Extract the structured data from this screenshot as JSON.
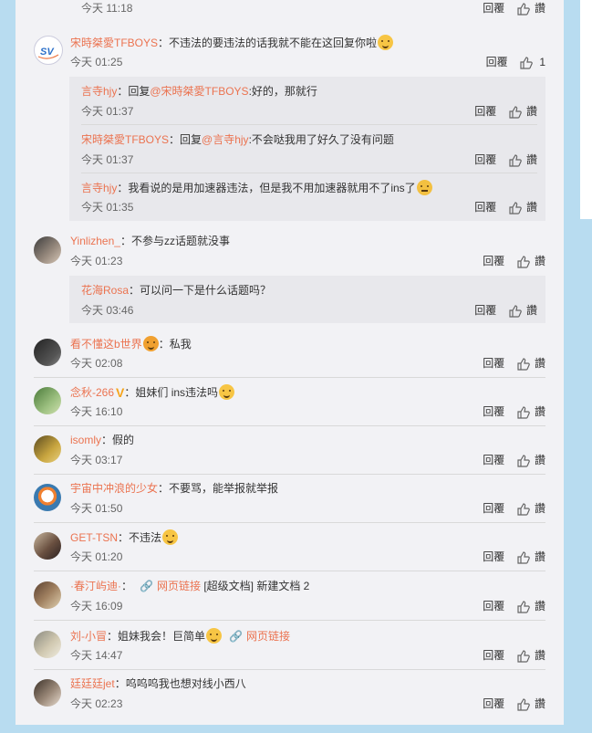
{
  "labels": {
    "reply": "回覆"
  },
  "colors": {
    "username": "#eb7350",
    "panel_bg": "#f2f2f5",
    "subbox_bg": "#e8e8ec",
    "page_bg": "#b8dcf0"
  },
  "top_partial": {
    "time": "今天 11:18"
  },
  "comments": [
    {
      "user": "宋時桀愛TFBOYS",
      "text": "：不违法的要违法的话我就不能在这回复你啦",
      "emoji": "smile-emoji",
      "time": "今天 01:25",
      "likes": "1",
      "avatar": "sv-logo-avatar",
      "replies": [
        {
          "user": "言寺hjy",
          "prefix": "：回复",
          "mention": "@宋時桀愛TFBOYS",
          "text": ":好的，那就行",
          "time": "今天 01:37"
        },
        {
          "user": "宋時桀愛TFBOYS",
          "prefix": "：回复",
          "mention": "@言寺hjy",
          "text": ":不会哒我用了好久了没有问题",
          "time": "今天 01:37"
        },
        {
          "user": "言寺hjy",
          "prefix": "",
          "mention": "",
          "text": "：我看说的是用加速器违法，但是我不用加速器就用不了ins了",
          "emoji": "cry-emoji",
          "time": "今天 01:35"
        }
      ]
    },
    {
      "user": "Yinlizhen_",
      "text": "：不参与zz话题就没事",
      "time": "今天 01:23",
      "avatar": "girl-avatar",
      "replies": [
        {
          "user": "花海Rosa",
          "prefix": "",
          "mention": "",
          "text": "：可以问一下是什么话题吗？",
          "time": "今天 03:46"
        }
      ]
    },
    {
      "user": "看不懂这b世界",
      "text": "：私我",
      "time": "今天 02:08",
      "avatar": "dark-avatar",
      "emoji_after_user": "badge-emoji"
    },
    {
      "user": "念秋-266",
      "text": "：姐妹们 ins违法吗",
      "time": "今天 16:10",
      "avatar": "green-avatar",
      "vip": "V",
      "emoji": "laugh-emoji"
    },
    {
      "user": "isomly",
      "text": "：假的",
      "time": "今天 03:17",
      "avatar": "yellow-avatar"
    },
    {
      "user": "宇宙中冲浪的少女",
      "text": "：不要骂，能举报就举报",
      "time": "今天 01:50",
      "avatar": "cartoon-avatar"
    },
    {
      "user": "GET-TSN",
      "text": "：不违法",
      "time": "今天 01:20",
      "avatar": "boy-avatar",
      "emoji": "laugh-emoji"
    },
    {
      "user": "·春汀屿迪·",
      "text": "：",
      "weblink": "网页链接",
      "after_link": " [超级文档] 新建文档 2",
      "time": "今天 16:09",
      "avatar": "couple-avatar"
    },
    {
      "user": "刘-小冒",
      "text": "：姐妹我会！巨简单",
      "weblink": "网页链接",
      "time": "今天 14:47",
      "avatar": "cat-avatar",
      "emoji": "shock-emoji"
    },
    {
      "user": "廷廷廷jet",
      "text": "：呜呜呜我也想对线小西八",
      "time": "今天 02:23",
      "avatar": "face-avatar"
    }
  ]
}
